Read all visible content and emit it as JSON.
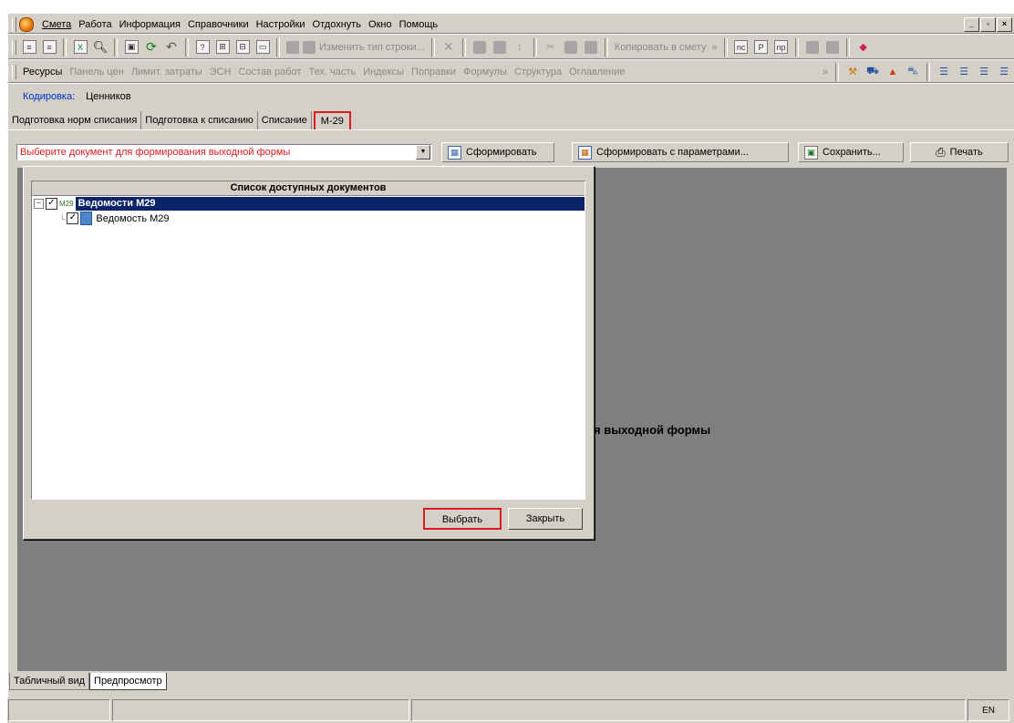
{
  "menu": {
    "items": [
      "Смета",
      "Работа",
      "Информация",
      "Справочники",
      "Настройки",
      "Отдохнуть",
      "Окно",
      "Помощь"
    ]
  },
  "toolbar1": {
    "change_row_type": "Изменить тип строки...",
    "copy_to_estimate": "Копировать в смету"
  },
  "toolbar2": {
    "items": [
      "Ресурсы",
      "Панель цен",
      "Лимит. затраты",
      "ЭСН",
      "Состав работ",
      "Тех. часть",
      "Индексы",
      "Поправки",
      "Формулы",
      "Структура",
      "Оглавление"
    ],
    "active_item": "Ресурсы"
  },
  "encoding": {
    "label": "Кодировка:",
    "value": "Ценников"
  },
  "tabs": [
    "Подготовка норм списания",
    "Подготовка к списанию",
    "Списание",
    "М-29"
  ],
  "active_tab": "М-29",
  "doc_select": {
    "placeholder": "Выберите документ для формирования выходной формы"
  },
  "actions": {
    "form": "Сформировать",
    "form_params": "Сформировать с параметрами...",
    "save": "Сохранить...",
    "print": "Печать"
  },
  "background_message": "я выходной формы",
  "dialog": {
    "title": "Список доступных документов",
    "tree": {
      "root_label": "Ведомости М29",
      "root_icon_text": "M29",
      "child_label": "Ведомость М29"
    },
    "select_button": "Выбрать",
    "close_button": "Закрыть"
  },
  "bottom_tabs": [
    "Табличный вид",
    "Предпросмотр"
  ],
  "active_bottom_tab": "Предпросмотр",
  "status": {
    "language": "EN"
  },
  "colors": {
    "accent_red": "#e0191e",
    "selection": "#0a246a",
    "link_blue": "#0033cc",
    "workarea": "#7f7f7f"
  }
}
